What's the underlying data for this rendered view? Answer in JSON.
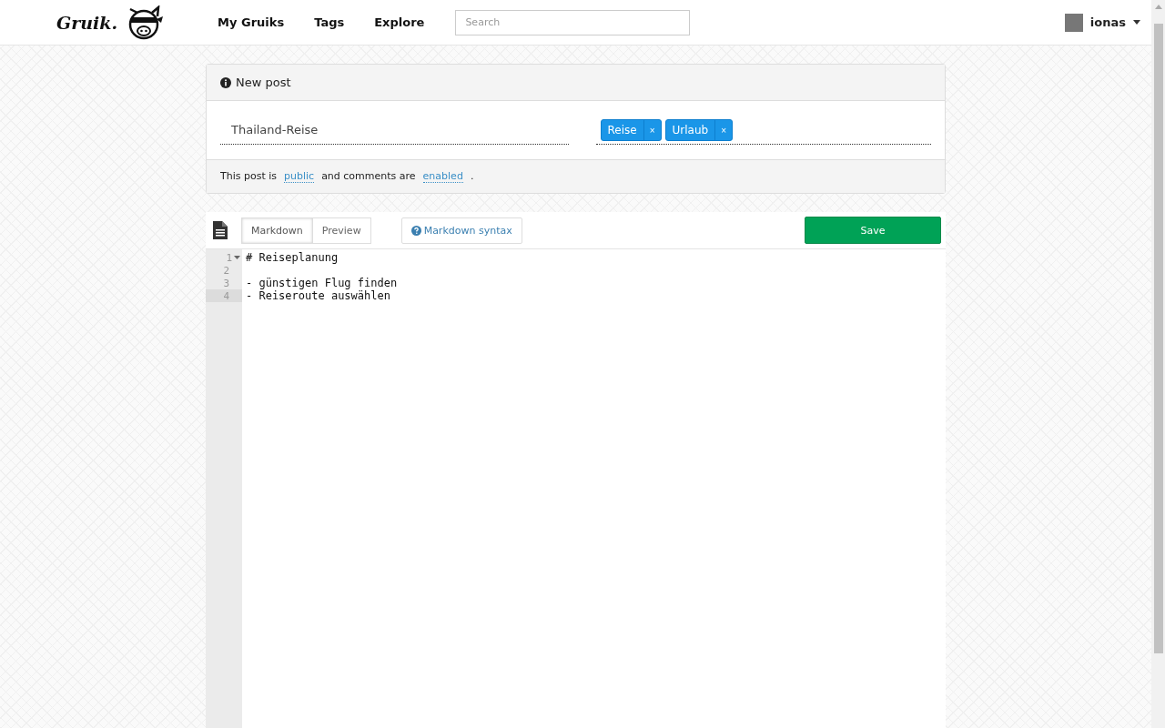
{
  "navbar": {
    "logo": "Gruik.",
    "links": [
      "My Gruiks",
      "Tags",
      "Explore"
    ],
    "search": {
      "placeholder": "Search"
    },
    "user": {
      "name": "ionas"
    }
  },
  "post_panel": {
    "heading": "New post",
    "title_value": "Thailand-Reise",
    "tags": [
      {
        "label": "Reise",
        "remove": "×"
      },
      {
        "label": "Urlaub",
        "remove": "×"
      }
    ],
    "footer": {
      "text_1": "This post is",
      "visibility": "public",
      "text_2": "and comments are",
      "comments": "enabled",
      "text_3": "."
    }
  },
  "editor": {
    "tabs": [
      {
        "label": "Markdown",
        "selected": true
      },
      {
        "label": "Preview",
        "selected": false
      }
    ],
    "help_button": "Markdown syntax",
    "save_button": "Save",
    "lines": [
      {
        "number": "1",
        "text": "# Reiseplanung",
        "active": false,
        "foldable": true
      },
      {
        "number": "2",
        "active": false,
        "foldable": false
      },
      {
        "number": "3",
        "text": "- günstigen Flug finden",
        "active": false,
        "foldable": false
      },
      {
        "number": "4",
        "text": "- Reiseroute auswählen",
        "active": true,
        "foldable": false
      }
    ]
  }
}
